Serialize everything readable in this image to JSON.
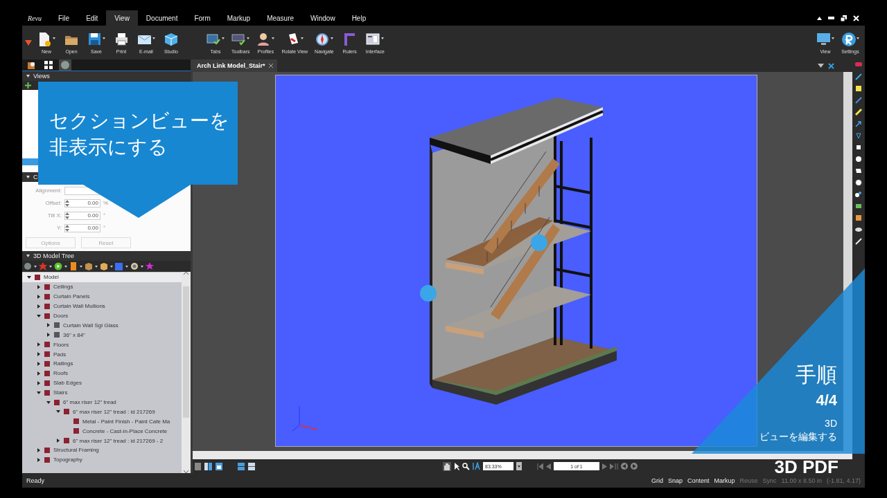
{
  "menu_bar": {
    "logo": "Revu",
    "items": [
      {
        "label": "File",
        "selected": false
      },
      {
        "label": "Edit",
        "selected": false
      },
      {
        "label": "View",
        "selected": true
      },
      {
        "label": "Document",
        "selected": false
      },
      {
        "label": "Form",
        "selected": false
      },
      {
        "label": "Markup",
        "selected": false
      },
      {
        "label": "Measure",
        "selected": false
      },
      {
        "label": "Window",
        "selected": false
      },
      {
        "label": "Help",
        "selected": false
      }
    ]
  },
  "toolbar": {
    "left": [
      {
        "label": "New",
        "dropdown": true
      },
      {
        "label": "Open",
        "dropdown": false
      },
      {
        "label": "Save",
        "dropdown": true
      },
      {
        "label": "Print",
        "dropdown": false
      },
      {
        "label": "E-mail",
        "dropdown": true
      },
      {
        "label": "Studio",
        "dropdown": false
      }
    ],
    "middle": [
      {
        "label": "Tabs",
        "dropdown": true
      },
      {
        "label": "Toolbars",
        "dropdown": true
      },
      {
        "label": "Profiles",
        "dropdown": true
      },
      {
        "label": "Rotate View",
        "dropdown": true
      },
      {
        "label": "Navigate",
        "dropdown": true
      },
      {
        "label": "Rulers",
        "dropdown": false
      },
      {
        "label": "Interface",
        "dropdown": true
      }
    ],
    "right": [
      {
        "label": "View",
        "dropdown": true
      },
      {
        "label": "Settings",
        "dropdown": true
      }
    ]
  },
  "left_panel": {
    "views_header": "Views",
    "section_header": "C",
    "properties": [
      {
        "label": "Alignment:",
        "kind": "blank"
      },
      {
        "label": "Offset:",
        "kind": "spinner",
        "value": "0.00",
        "unit": "%"
      },
      {
        "label": "Tilt X:",
        "kind": "spinner",
        "value": "0.00",
        "unit": "°"
      },
      {
        "label": "Y:",
        "kind": "spinner",
        "value": "0.00",
        "unit": "°"
      }
    ],
    "buttons": [
      {
        "label": "Options",
        "disabled": true
      },
      {
        "label": "Reset",
        "disabled": true
      }
    ],
    "model_tree": {
      "title": "3D Model Tree",
      "items": [
        {
          "label": "Model",
          "kind": "node",
          "expanded": true,
          "color": "#8b2232",
          "children": [
            {
              "label": "Ceilings",
              "kind": "node",
              "expanded": false,
              "color": "#8b2232"
            },
            {
              "label": "Curtain Panels",
              "kind": "node",
              "expanded": false,
              "color": "#8b2232"
            },
            {
              "label": "Curtain Wall Mullions",
              "kind": "node",
              "expanded": false,
              "color": "#8b2232"
            },
            {
              "label": "Doors",
              "kind": "node",
              "expanded": true,
              "color": "#8b2232",
              "children": [
                {
                  "label": "Curtain Wall Sgl Glass",
                  "kind": "node",
                  "expanded": false,
                  "color": "#55555a"
                },
                {
                  "label": "36\" x 84\"",
                  "kind": "node",
                  "expanded": false,
                  "color": "#55555a"
                }
              ]
            },
            {
              "label": "Floors",
              "kind": "node",
              "expanded": false,
              "color": "#8b2232"
            },
            {
              "label": "Pads",
              "kind": "node",
              "expanded": false,
              "color": "#8b2232"
            },
            {
              "label": "Railings",
              "kind": "node",
              "expanded": false,
              "color": "#8b2232"
            },
            {
              "label": "Roofs",
              "kind": "node",
              "expanded": false,
              "color": "#8b2232"
            },
            {
              "label": "Slab Edges",
              "kind": "node",
              "expanded": false,
              "color": "#8b2232"
            },
            {
              "label": "Stairs",
              "kind": "node",
              "expanded": true,
              "color": "#8b2232",
              "children": [
                {
                  "label": "6\" max riser 12\" tread",
                  "kind": "node",
                  "expanded": true,
                  "color": "#8b2232",
                  "children": [
                    {
                      "label": "6\" max riser 12\" tread : id 217269",
                      "kind": "node",
                      "expanded": true,
                      "color": "#8b2232",
                      "children": [
                        {
                          "label": "Metal - Paint Finish - Paint Cafe Ma",
                          "kind": "leaf",
                          "color": "#8b2232"
                        },
                        {
                          "label": "Concrete - Cast-in-Place Concrete",
                          "kind": "leaf",
                          "color": "#8b2232"
                        }
                      ]
                    },
                    {
                      "label": "6\" max riser 12\" tread : id 217269 - 2",
                      "kind": "node",
                      "expanded": false,
                      "color": "#8b2232"
                    }
                  ]
                }
              ]
            },
            {
              "label": "Structural Framing",
              "kind": "node",
              "expanded": false,
              "color": "#8b2232"
            },
            {
              "label": "Topography",
              "kind": "node",
              "expanded": false,
              "color": "#8b2232"
            }
          ]
        }
      ]
    }
  },
  "document": {
    "tab_title": "Arch Link Model_Stair*"
  },
  "navigation": {
    "zoom": "83.33%",
    "page": "1 of 1"
  },
  "status_bar": {
    "state": "Ready",
    "toggles": [
      "Grid",
      "Snap",
      "Content",
      "Markup",
      "Reuse",
      "Sync"
    ],
    "page_size": "11.00 x 8.50 in",
    "coordinates": "(-1.81, 4.17)"
  },
  "callout": {
    "text": "セクションビューを非表示にする"
  },
  "step_overlay": {
    "title": "手順",
    "step": "4/4",
    "caption_1": "3D",
    "caption_2": "ビューを編集する"
  },
  "badge": "3D PDF"
}
